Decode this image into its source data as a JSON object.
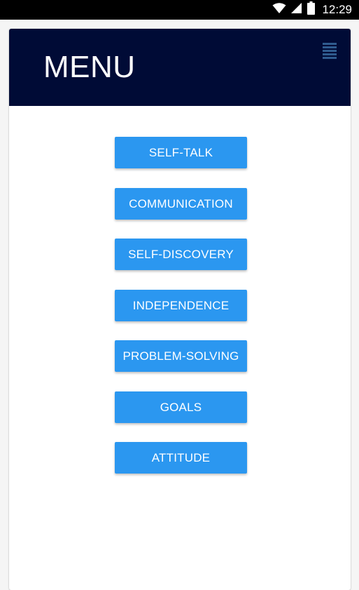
{
  "status_bar": {
    "time": "12:29",
    "icons": [
      "wifi-icon",
      "cell-signal-icon",
      "battery-icon"
    ]
  },
  "header": {
    "title": "MENU",
    "menu_icon": "hamburger-menu-icon",
    "background": "#000b36"
  },
  "menu": {
    "button_color": "#2b97f0",
    "items": [
      {
        "label": "SELF-TALK"
      },
      {
        "label": "COMMUNICATION"
      },
      {
        "label": "SELF-DISCOVERY"
      },
      {
        "label": "INDEPENDENCE"
      },
      {
        "label": "PROBLEM-SOLVING"
      },
      {
        "label": "GOALS"
      },
      {
        "label": "ATTITUDE"
      }
    ]
  }
}
